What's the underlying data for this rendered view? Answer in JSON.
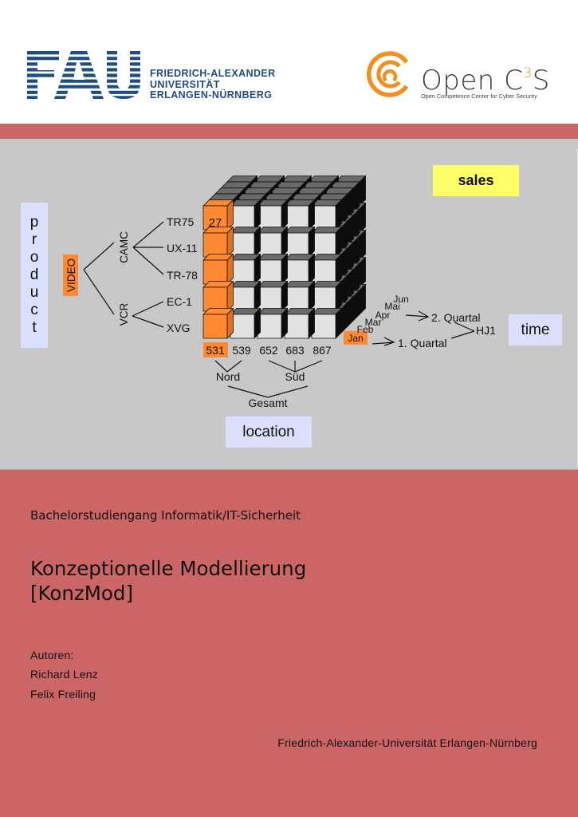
{
  "header": {
    "fau_logo_text": "FAU",
    "fau_name_lines": [
      "FRIEDRICH-ALEXANDER",
      "UNIVERSITÄT",
      "ERLANGEN-NÜRNBERG"
    ],
    "c3s_name": "Open C",
    "c3s_superscript": "3",
    "c3s_suffix": "S",
    "c3s_subtitle": "Open Competence Center for Cyber Security"
  },
  "colors": {
    "fau_blue": "#1f4e7e",
    "c3s_orange": "#f09020",
    "band_red": "#cc6666",
    "panel_gray": "#c8c8c8",
    "highlight_orange": "#ff8833",
    "label_blue": "#dbe0fd",
    "sales_yellow": "#ffff66"
  },
  "diagram": {
    "dimension_labels": {
      "product": "product",
      "sales": "sales",
      "time": "time",
      "location": "location"
    },
    "product_letters": [
      "p",
      "r",
      "o",
      "d",
      "u",
      "c",
      "t"
    ],
    "product_hierarchy": {
      "root": "VIDEO",
      "groups": [
        {
          "name": "CAMC",
          "items": [
            "TR75",
            "UX-11",
            "TR-78"
          ]
        },
        {
          "name": "VCR",
          "items": [
            "EC-1",
            "XVG"
          ]
        }
      ]
    },
    "cube_highlight_value": "27",
    "location_values": [
      "531",
      "539",
      "652",
      "683",
      "867"
    ],
    "location_hierarchy": {
      "groups": [
        {
          "name": "Nord",
          "values": [
            "531",
            "539"
          ]
        },
        {
          "name": "Süd",
          "values": [
            "652",
            "683",
            "867"
          ]
        }
      ],
      "root": "Gesamt"
    },
    "time_months": [
      "Jan",
      "Feb",
      "Mar",
      "Apr",
      "Mai",
      "Jun"
    ],
    "time_hierarchy": {
      "quarters": [
        "1. Quartal",
        "2. Quartal"
      ],
      "half_year": "HJ1"
    }
  },
  "cover": {
    "program": "Bachelorstudiengang Informatik/IT-Sicherheit",
    "title_line1": "Konzeptionelle Modellierung",
    "title_line2": "[KonzMod]",
    "authors_label": "Autoren:",
    "authors": [
      "Richard Lenz",
      "Felix Freiling"
    ],
    "university": "Friedrich-Alexander-Universität Erlangen-Nürnberg"
  }
}
